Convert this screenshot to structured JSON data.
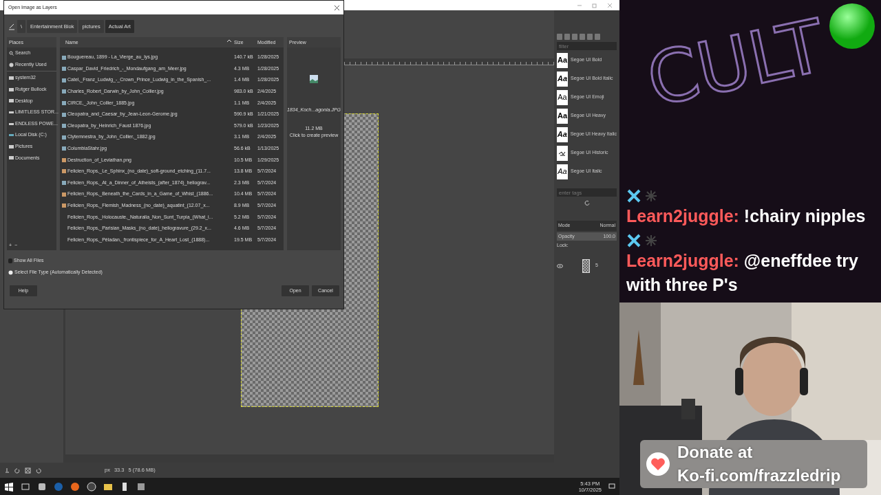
{
  "gimp": {
    "dialog": {
      "title": "Open Image as Layers",
      "path": [
        {
          "label": "\\",
          "selected": false
        },
        {
          "label": "Entertainment Blok",
          "selected": false
        },
        {
          "label": "pictures",
          "selected": false
        },
        {
          "label": "Actual Art",
          "selected": true
        }
      ],
      "places_header": "Places",
      "places_system": [
        {
          "label": "Search",
          "kind": "search"
        },
        {
          "label": "Recently Used",
          "kind": "recent"
        }
      ],
      "places_bookmarks": [
        {
          "label": "system32",
          "kind": "folder"
        },
        {
          "label": "Rutger Bullock",
          "kind": "folder"
        },
        {
          "label": "Desktop",
          "kind": "folder"
        },
        {
          "label": "LIMITLESS STOR...",
          "kind": "drive"
        },
        {
          "label": "ENDLESS POWE...",
          "kind": "drive"
        },
        {
          "label": "Local Disk (C:)",
          "kind": "disk"
        },
        {
          "label": "Pictures",
          "kind": "folder"
        },
        {
          "label": "Documents",
          "kind": "folder"
        }
      ],
      "place_buttons": [
        "+",
        "−"
      ],
      "columns": [
        {
          "label": "Name",
          "sorted": true
        },
        {
          "label": "Size",
          "sorted": false
        },
        {
          "label": "Modified",
          "sorted": false
        }
      ],
      "files": [
        {
          "name": "Bouguereau, 1899 - La_Vierge_au_lys.jpg",
          "size": "140.7 kB",
          "modified": "1/28/2025",
          "kind": "jpg"
        },
        {
          "name": "Caspar_David_Friedrich_-_Mondaufgang_am_Meer.jpg",
          "size": "4.3 MB",
          "modified": "1/28/2025",
          "kind": "jpg"
        },
        {
          "name": "Catel,_Franz_Ludwig_-_Crown_Prince_Ludwig_in_the_Spanish_...",
          "size": "1.4 MB",
          "modified": "1/28/2025",
          "kind": "jpg"
        },
        {
          "name": "Charles_Robert_Darwin_by_John_Collier.jpg",
          "size": "983.0 kB",
          "modified": "2/4/2025",
          "kind": "jpg"
        },
        {
          "name": "CIRCE,_John_Collier_1885.jpg",
          "size": "1.1 MB",
          "modified": "2/4/2025",
          "kind": "jpg"
        },
        {
          "name": "Cleopatra_and_Caesar_by_Jean-Leon-Gerome.jpg",
          "size": "590.9 kB",
          "modified": "1/21/2025",
          "kind": "jpg"
        },
        {
          "name": "Cleopatra_by_Heinrich_Faust 1876.jpg",
          "size": "579.0 kB",
          "modified": "1/23/2025",
          "kind": "jpg"
        },
        {
          "name": "Clytemnestra_by_John_Collier,_1882.jpg",
          "size": "3.1 MB",
          "modified": "2/4/2025",
          "kind": "jpg"
        },
        {
          "name": "ColumbiaStahr.jpg",
          "size": "56.6 kB",
          "modified": "1/13/2025",
          "kind": "jpg"
        },
        {
          "name": "Destruction_of_Leviathan.png",
          "size": "10.5 MB",
          "modified": "1/29/2025",
          "kind": "png"
        },
        {
          "name": "Felicien_Rops,_Le_Sphinx_(no_date)_soft-ground_etching_(11.7...",
          "size": "13.8 MB",
          "modified": "5/7/2024",
          "kind": "png"
        },
        {
          "name": "Felicien_Rops,_At_a_Dinner_of_Atheists_(after_1874)_heliograv...",
          "size": "2.3 MB",
          "modified": "5/7/2024",
          "kind": "jpg"
        },
        {
          "name": "Felicien_Rops,_Beneath_the_Cards_in_a_Game_of_Whist_(1886...",
          "size": "10.4 MB",
          "modified": "5/7/2024",
          "kind": "png"
        },
        {
          "name": "Felicien_Rops,_Flemish_Madness_(no_date)_aquatint_(12.07_x...",
          "size": "8.9 MB",
          "modified": "5/7/2024",
          "kind": "png"
        },
        {
          "name": "Felicien_Rops,_Holocauste,_Naturalia_Non_Sunt_Turpia_(What_i...",
          "size": "5.2 MB",
          "modified": "5/7/2024",
          "kind": "none"
        },
        {
          "name": "Felicien_Rops,_Parisian_Masks_(no_date)_heliogravure_(29.2_x...",
          "size": "4.6 MB",
          "modified": "5/7/2024",
          "kind": "none"
        },
        {
          "name": "Felicien_Rops,_Péladan,_frontispiece_for_A_Heart_Lost_(1888)...",
          "size": "19.5 MB",
          "modified": "5/7/2024",
          "kind": "none"
        }
      ],
      "preview_header": "Preview",
      "preview_file": "1834_Koch...agonia.JPG",
      "preview_size": "11.2 MB",
      "preview_hint": "Click to create preview",
      "show_all": {
        "label": "Show All Files",
        "checked": false
      },
      "file_type": {
        "label": "Select File Type (Automatically Detected)",
        "expanded": false
      },
      "buttons": [
        {
          "label": "Help",
          "kind": "help"
        },
        {
          "label": "Open",
          "kind": "action"
        },
        {
          "label": "Cancel",
          "kind": "action"
        }
      ]
    },
    "fonts_filter": {
      "placeholder": "filter"
    },
    "fonts": [
      {
        "sample": "Aa",
        "name": "Segoe UI Bold",
        "kind": "bold"
      },
      {
        "sample": "Aa",
        "name": "Segoe UI Bold Italic",
        "kind": "bolditalic"
      },
      {
        "sample": "Aa",
        "name": "Segoe UI Emoji",
        "kind": "regular"
      },
      {
        "sample": "Aa",
        "name": "Segoe UI Heavy",
        "kind": "heavy"
      },
      {
        "sample": "Aa",
        "name": "Segoe UI Heavy Italic",
        "kind": "heavyitalic"
      },
      {
        "name": "Segoe UI Historic",
        "kind": "script"
      },
      {
        "sample": "Aa",
        "name": "Segoe UI Italic",
        "kind": "italic"
      }
    ],
    "tags_field": {
      "placeholder": "enter tags"
    },
    "layers": {
      "mode_label": "Mode",
      "mode": "Normal",
      "opacity_label": "Opacity",
      "opacity": "100.0",
      "lock_label": "Lock:",
      "items": [
        {
          "name": "5",
          "visible": true
        }
      ]
    },
    "status": {
      "unit": "px",
      "zoom": "33.3",
      "info": "5 (78.6 MB)"
    }
  },
  "taskbar": {
    "time": "5:43 PM",
    "date": "10/7/2025"
  },
  "stream": {
    "logo": "CULT",
    "chat": [
      {
        "user": "Learn2juggle:",
        "message": "!chairy nipples"
      },
      {
        "user": "Learn2juggle:",
        "message": "@eneffdee try with three P's"
      }
    ],
    "donate": [
      "Donate at",
      "Ko-fi.com/frazzledrip"
    ]
  }
}
